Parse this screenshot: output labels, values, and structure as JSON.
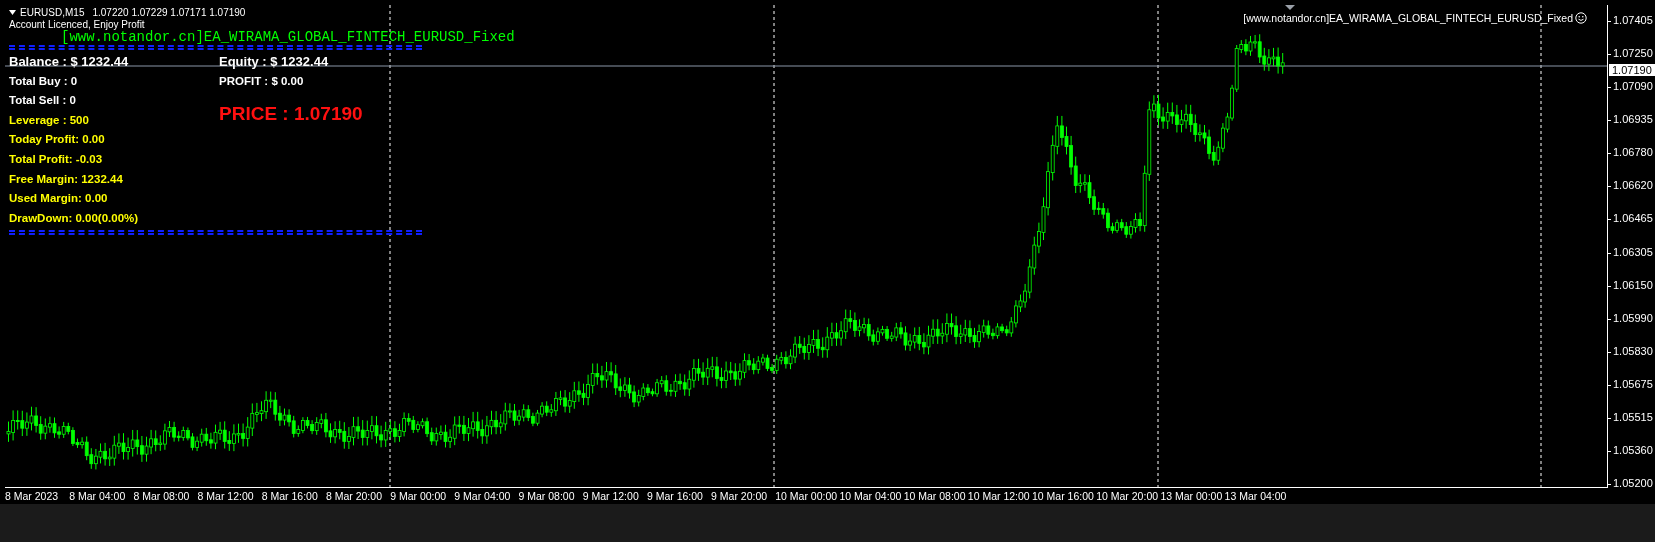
{
  "chart_header": {
    "symbol": "EURUSD,M15",
    "ohlc": "1.07220 1.07229 1.07171 1.07190"
  },
  "notice": "Account Licenced, Enjoy Profit",
  "ea_banner": "[www.notandor.cn]EA_WIRAMA_GLOBAL_FINTECH_EURUSD_Fixed",
  "ea_label": "[www.notandor.cn]EA_WIRAMA_GLOBAL_FINTECH_EURUSD_Fixed",
  "stats_left": [
    {
      "text": "Balance : $ 1232.44",
      "kind": "headline",
      "color": "#ffffff"
    },
    {
      "text": "Total Buy  : 0",
      "kind": "line",
      "color": "#ffffff"
    },
    {
      "text": "Total Sell  : 0",
      "kind": "line",
      "color": "#ffffff"
    },
    {
      "text": "Leverage : 500",
      "kind": "line",
      "color": "#ffff00"
    },
    {
      "text": "Today Profit: 0.00",
      "kind": "line",
      "color": "#ffff00"
    },
    {
      "text": "Total Profit: -0.03",
      "kind": "line",
      "color": "#ffff00"
    },
    {
      "text": "Free Margin: 1232.44",
      "kind": "line",
      "color": "#ffff00"
    },
    {
      "text": "Used Margin: 0.00",
      "kind": "line",
      "color": "#ffff00"
    },
    {
      "text": "DrawDown: 0.00(0.00%)",
      "kind": "line",
      "color": "#ffff00"
    }
  ],
  "stats_right": [
    {
      "text": "Equity : $ 1232.44",
      "kind": "headline",
      "color": "#ffffff"
    },
    {
      "text": "PROFIT  : $ 0.00",
      "kind": "line",
      "color": "#ffffff"
    }
  ],
  "price_banner": "PRICE : 1.07190",
  "price_axis": {
    "ticks": [
      "1.07405",
      "1.07250",
      "1.07090",
      "1.06935",
      "1.06780",
      "1.06620",
      "1.06465",
      "1.06305",
      "1.06150",
      "1.05990",
      "1.05830",
      "1.05675",
      "1.05515",
      "1.05360",
      "1.05200"
    ],
    "current_price": "1.07190"
  },
  "time_axis": [
    "8 Mar 2023",
    "8 Mar 04:00",
    "8 Mar 08:00",
    "8 Mar 12:00",
    "8 Mar 16:00",
    "8 Mar 20:00",
    "9 Mar 00:00",
    "9 Mar 04:00",
    "9 Mar 08:00",
    "9 Mar 12:00",
    "9 Mar 16:00",
    "9 Mar 20:00",
    "10 Mar 00:00",
    "10 Mar 04:00",
    "10 Mar 08:00",
    "10 Mar 12:00",
    "10 Mar 16:00",
    "10 Mar 20:00",
    "13 Mar 00:00",
    "13 Mar 04:00"
  ]
}
